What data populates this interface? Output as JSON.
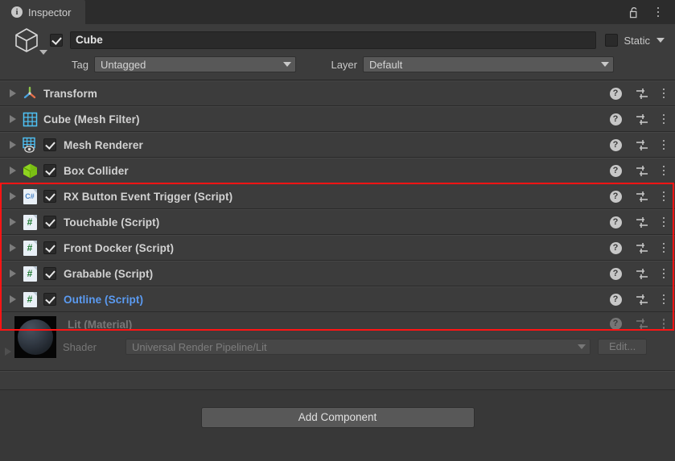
{
  "window": {
    "tab_label": "Inspector",
    "tab_icon": "info-icon",
    "lock_icon": "lock-open-icon",
    "menu_icon": "kebab-menu-icon"
  },
  "gameobject": {
    "icon": "cube-wireframe-icon",
    "enabled": true,
    "name": "Cube",
    "static_label": "Static",
    "static_checked": false,
    "tag_label": "Tag",
    "tag_value": "Untagged",
    "layer_label": "Layer",
    "layer_value": "Default"
  },
  "components": [
    {
      "name": "Transform",
      "icon": "transform-axis-icon",
      "has_checkbox": false,
      "enabled": false,
      "highlighted": false,
      "in_red_box": false
    },
    {
      "name": "Cube (Mesh Filter)",
      "icon": "mesh-filter-grid-icon",
      "has_checkbox": false,
      "enabled": false,
      "highlighted": false,
      "in_red_box": false
    },
    {
      "name": "Mesh Renderer",
      "icon": "mesh-renderer-eye-icon",
      "has_checkbox": true,
      "enabled": true,
      "highlighted": false,
      "in_red_box": false
    },
    {
      "name": "Box Collider",
      "icon": "box-collider-green-cube-icon",
      "has_checkbox": true,
      "enabled": true,
      "highlighted": false,
      "in_red_box": false
    },
    {
      "name": "RX Button Event Trigger (Script)",
      "icon": "csharp-script-icon",
      "has_checkbox": true,
      "enabled": true,
      "highlighted": false,
      "in_red_box": true
    },
    {
      "name": "Touchable (Script)",
      "icon": "hash-script-icon",
      "has_checkbox": true,
      "enabled": true,
      "highlighted": false,
      "in_red_box": true
    },
    {
      "name": "Front Docker (Script)",
      "icon": "hash-script-icon",
      "has_checkbox": true,
      "enabled": true,
      "highlighted": false,
      "in_red_box": true
    },
    {
      "name": "Grabable (Script)",
      "icon": "hash-script-icon",
      "has_checkbox": true,
      "enabled": true,
      "highlighted": false,
      "in_red_box": true
    },
    {
      "name": "Outline (Script)",
      "icon": "hash-script-icon",
      "has_checkbox": true,
      "enabled": true,
      "highlighted": true,
      "in_red_box": true
    }
  ],
  "row_actions": {
    "help_icon": "help-question-icon",
    "preset_icon": "preset-sliders-icon",
    "menu_icon": "kebab-menu-icon"
  },
  "material": {
    "title": "Lit (Material)",
    "preview_icon": "material-sphere-preview",
    "shader_label": "Shader",
    "shader_value": "Universal Render Pipeline/Lit",
    "edit_label": "Edit..."
  },
  "footer": {
    "add_component_label": "Add Component"
  },
  "annotation": {
    "highlight_color": "#ff1414"
  }
}
